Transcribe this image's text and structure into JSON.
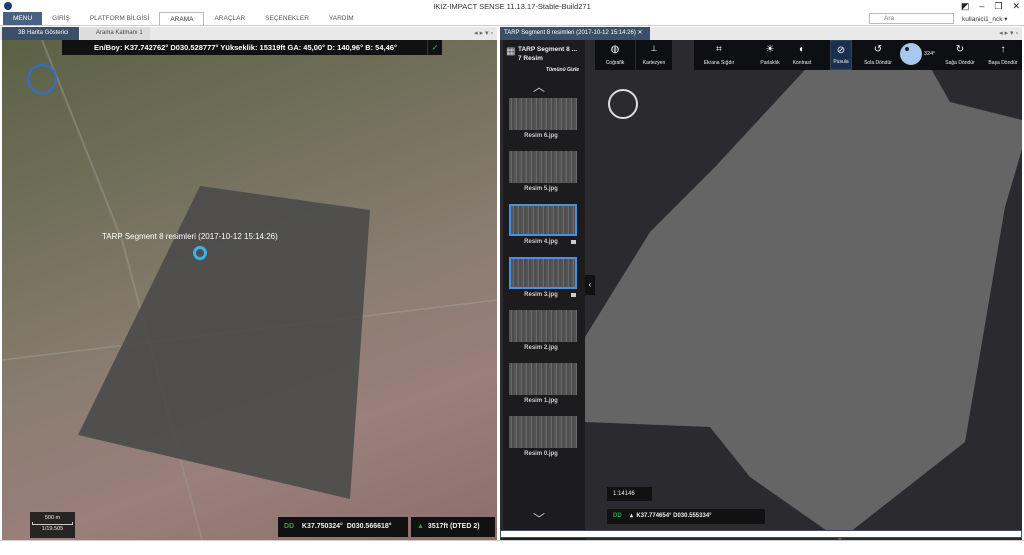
{
  "window": {
    "title": "IKIZ-IMPACT SENSE 11.13.17-Stable-Build271"
  },
  "menu": [
    "MENU",
    "GİRİŞ",
    "PLATFORM BİLGİSİ",
    "ARAMA",
    "ARAÇLAR",
    "SEÇENEKLER",
    "YARDIM"
  ],
  "search": {
    "placeholder": "Ara"
  },
  "user": "kullanici1_nck ▾",
  "left": {
    "tabs": [
      "3B Harita Gösterici",
      "Arama Katmanı 1"
    ],
    "coord_bar": "En/Boy: K37.742762° D030.528777° Yükseklik: 15319ft GA: 45,00° D: 140,96° B: 54,46°",
    "overlay_label": "TARP  Segment 8  resimleri (2017-10-12 15:14:26)",
    "scale": {
      "distance": "500 m",
      "ratio": "1/19.505"
    },
    "status": {
      "format": "DD",
      "lat": "K37.750324°",
      "lon": "D030.566618°",
      "elevation": "3517ft (DTED 2)"
    }
  },
  "right": {
    "tab": "TARP  Segment 8  resimleri (2017-10-12 15:14:26)",
    "panel": {
      "title": "TARP  Segment 8 ...",
      "count": "7 Resim",
      "hide_all": "Tümünü Gizle",
      "images": [
        {
          "name": "Resim 6.jpg",
          "selected": false
        },
        {
          "name": "Resim 5.jpg",
          "selected": false
        },
        {
          "name": "Resim 4.jpg",
          "selected": true
        },
        {
          "name": "Resim 3.jpg",
          "selected": true
        },
        {
          "name": "Resim 2.jpg",
          "selected": false
        },
        {
          "name": "Resim 1.jpg",
          "selected": false
        },
        {
          "name": "Resim 0.jpg",
          "selected": false
        }
      ]
    },
    "toolbar": {
      "geographic": "Coğrafik",
      "cartesian": "Kartezyen",
      "fit": "Ekrana Sığdır",
      "brightness": "Parlaklık",
      "contrast": "Kontrast",
      "compass": "Pusula",
      "rotate_left": "Sola Döndür",
      "angle": "324°",
      "rotate_right": "Sağa Döndür",
      "reset": "Başa Döndür"
    },
    "scale": "1:14146",
    "status": {
      "format": "DD",
      "coords": "K37.774654° D030.555334°"
    }
  },
  "colors": {
    "accent": "#3d4f68",
    "selection": "#4a8fe0",
    "status_green": "#1fa64a"
  }
}
